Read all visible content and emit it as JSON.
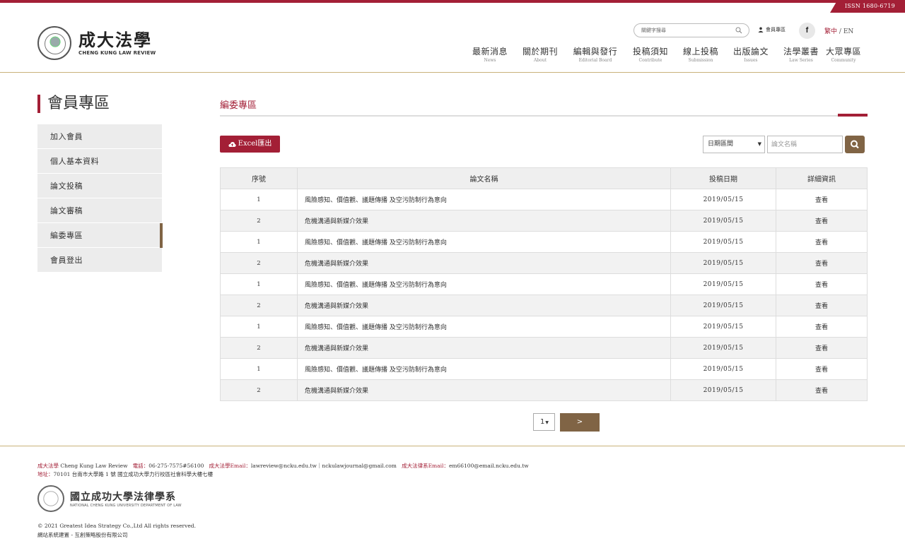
{
  "issn": "ISSN 1680-6719",
  "brand": {
    "title_cn": "成大法學",
    "title_en": "CHENG KUNG LAW REVIEW"
  },
  "header": {
    "search_placeholder": "關鍵字搜尋",
    "member_link": "會員專區",
    "fb_label": "f",
    "lang_zh": "繁中",
    "lang_sep": "/",
    "lang_en": "EN"
  },
  "nav": [
    {
      "cn": "最新消息",
      "en": "News"
    },
    {
      "cn": "關於期刊",
      "en": "About"
    },
    {
      "cn": "編輯與發行",
      "en": "Editorial Board"
    },
    {
      "cn": "投稿須知",
      "en": "Contribute"
    },
    {
      "cn": "線上投稿",
      "en": "Submission"
    },
    {
      "cn": "出版論文",
      "en": "Issues"
    },
    {
      "cn": "法學叢書",
      "en": "Law Series"
    },
    {
      "cn": "大眾專區",
      "en": "Community"
    }
  ],
  "sidebar": {
    "title": "會員專區",
    "items": [
      {
        "label": "加入會員"
      },
      {
        "label": "個人基本資料"
      },
      {
        "label": "論文投稿"
      },
      {
        "label": "論文審稿"
      },
      {
        "label": "編委專區",
        "active": true
      },
      {
        "label": "會員登出"
      }
    ]
  },
  "main": {
    "section_title": "編委專區",
    "excel_label": "Excel匯出",
    "filter_select": "日期區間",
    "filter_placeholder": "論文名稱",
    "columns": [
      "序號",
      "論文名稱",
      "投稿日期",
      "詳細資訊"
    ],
    "rows": [
      {
        "no": "1",
        "title": "風險感知、價值觀、議題傳播 及空污防制行為意向",
        "date": "2019/05/15",
        "action": "查看"
      },
      {
        "no": "2",
        "title": "危機溝通與新媒介效果",
        "date": "2019/05/15",
        "action": "查看"
      },
      {
        "no": "1",
        "title": "風險感知、價值觀、議題傳播 及空污防制行為意向",
        "date": "2019/05/15",
        "action": "查看"
      },
      {
        "no": "2",
        "title": "危機溝通與新媒介效果",
        "date": "2019/05/15",
        "action": "查看"
      },
      {
        "no": "1",
        "title": "風險感知、價值觀、議題傳播 及空污防制行為意向",
        "date": "2019/05/15",
        "action": "查看"
      },
      {
        "no": "2",
        "title": "危機溝通與新媒介效果",
        "date": "2019/05/15",
        "action": "查看"
      },
      {
        "no": "1",
        "title": "風險感知、價值觀、議題傳播 及空污防制行為意向",
        "date": "2019/05/15",
        "action": "查看"
      },
      {
        "no": "2",
        "title": "危機溝通與新媒介效果",
        "date": "2019/05/15",
        "action": "查看"
      },
      {
        "no": "1",
        "title": "風險感知、價值觀、議題傳播 及空污防制行為意向",
        "date": "2019/05/15",
        "action": "查看"
      },
      {
        "no": "2",
        "title": "危機溝通與新媒介效果",
        "date": "2019/05/15",
        "action": "查看"
      }
    ],
    "pagination": {
      "page": "1",
      "next": ">"
    }
  },
  "footer": {
    "label_name": "成大法學",
    "name_en": "Cheng Kung Law Review",
    "label_phone": "電話：",
    "phone": "06-275-7575#56100",
    "label_email": "成大法學Email：",
    "email": "lawreview@ncku.edu.tw｜nckulawjournal@gmail.com",
    "label_dept_email": "成大法律系Email：",
    "dept_email": "em66100@email.ncku.edu.tw",
    "label_address": "地址：",
    "address": "70101 台南市大學路 1 號 國立成功大學力行校區社會科學大樓七樓",
    "dept_cn": "國立成功大學法律學系",
    "dept_en": "NATIONAL CHENG KUNG UNIVERSITY DEPARTMENT OF LAW",
    "copyright": "© 2021 Greatest Idea Strategy Co.,Ltd All rights reserved.",
    "builder": "網站系統建置 - 互創策略股份有限公司"
  },
  "colors": {
    "brand_red": "#a31f36",
    "brand_brown": "#806445",
    "gold_line": "#c9b27a"
  }
}
